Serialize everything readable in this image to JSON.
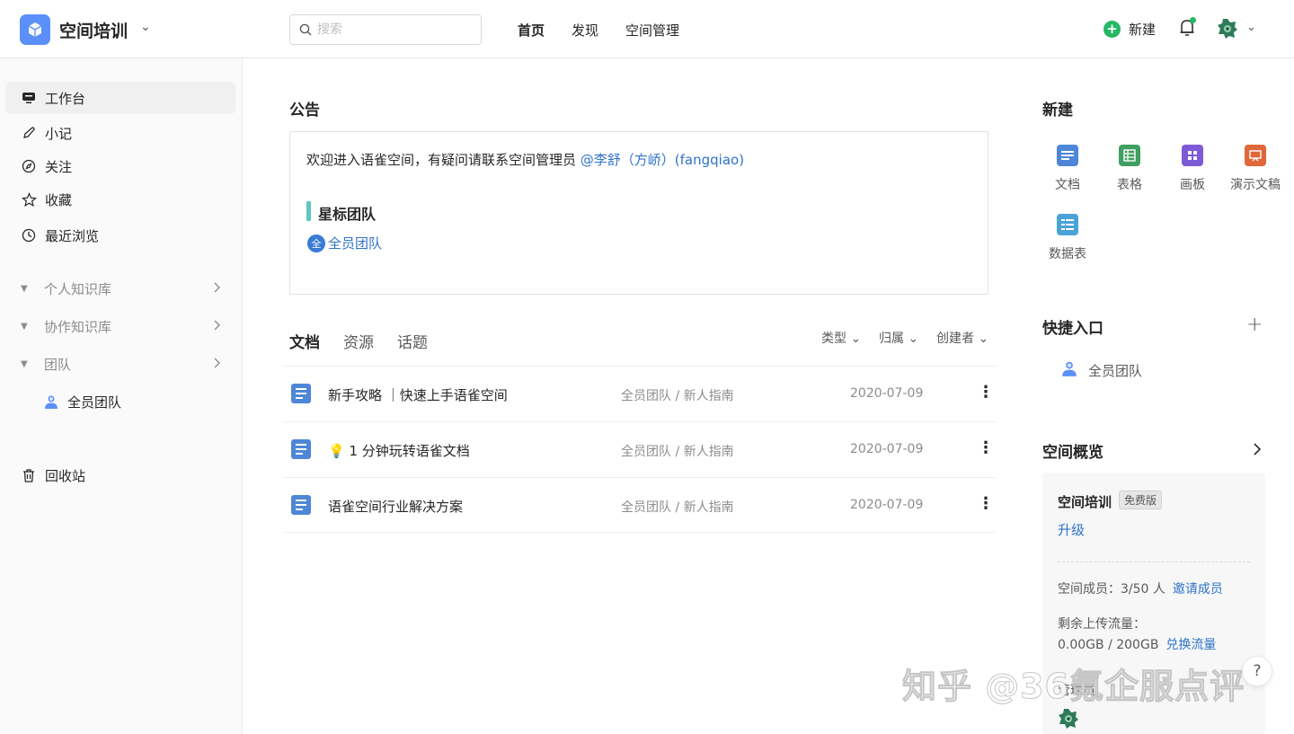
{
  "header": {
    "space_name": "空间培训",
    "search_placeholder": "搜索",
    "nav": [
      "首页",
      "发现",
      "空间管理"
    ],
    "new_label": "新建"
  },
  "sidebar": {
    "items": [
      {
        "label": "工作台",
        "icon": "workbench-icon"
      },
      {
        "label": "小记",
        "icon": "pen-icon"
      },
      {
        "label": "关注",
        "icon": "compass-icon"
      },
      {
        "label": "收藏",
        "icon": "star-icon"
      },
      {
        "label": "最近浏览",
        "icon": "clock-icon"
      }
    ],
    "groups": [
      "个人知识库",
      "协作知识库",
      "团队"
    ],
    "team_item": "全员团队",
    "trash": "回收站"
  },
  "notice": {
    "title": "公告",
    "text": "欢迎进入语雀空间，有疑问请联系空间管理员 ",
    "mention": "@李舒（方峤）(fangqiao)",
    "starred_title": "星标团队",
    "team_badge": "全",
    "team_name": "全员团队"
  },
  "tabs": [
    "文档",
    "资源",
    "话题"
  ],
  "filters": [
    "类型",
    "归属",
    "创建者"
  ],
  "docs": [
    {
      "title": "新手攻略 ｜快速上手语雀空间",
      "path": "全员团队 / 新人指南",
      "date": "2020-07-09"
    },
    {
      "title": "💡 1 分钟玩转语雀文档",
      "path": "全员团队 / 新人指南",
      "date": "2020-07-09"
    },
    {
      "title": "语雀空间行业解决方案",
      "path": "全员团队 / 新人指南",
      "date": "2020-07-09"
    }
  ],
  "new_panel": {
    "title": "新建",
    "tiles": [
      {
        "label": "文档",
        "color": "#4e86d8"
      },
      {
        "label": "表格",
        "color": "#3f9f5f"
      },
      {
        "label": "画板",
        "color": "#7d5bd6"
      },
      {
        "label": "演示文稿",
        "color": "#e0673a"
      },
      {
        "label": "数据表",
        "color": "#4aa3d6"
      }
    ]
  },
  "quick": {
    "title": "快捷入口",
    "plus": "+",
    "item": "全员团队"
  },
  "overview": {
    "title": "空间概览",
    "name": "空间培训",
    "badge": "免费版",
    "upgrade": "升级",
    "members_label": "空间成员：3/50 人",
    "invite": "邀请成员",
    "upload_label": "剩余上传流量：",
    "upload_value": "0.00GB / 200GB",
    "exchange": "兑换流量",
    "admin_label": "管理员"
  },
  "help": "?",
  "watermark": "知乎 @36氪企服点评",
  "colors": {
    "accent": "#2f73c9",
    "green": "#25b864",
    "logo": "#5b8ff9"
  }
}
